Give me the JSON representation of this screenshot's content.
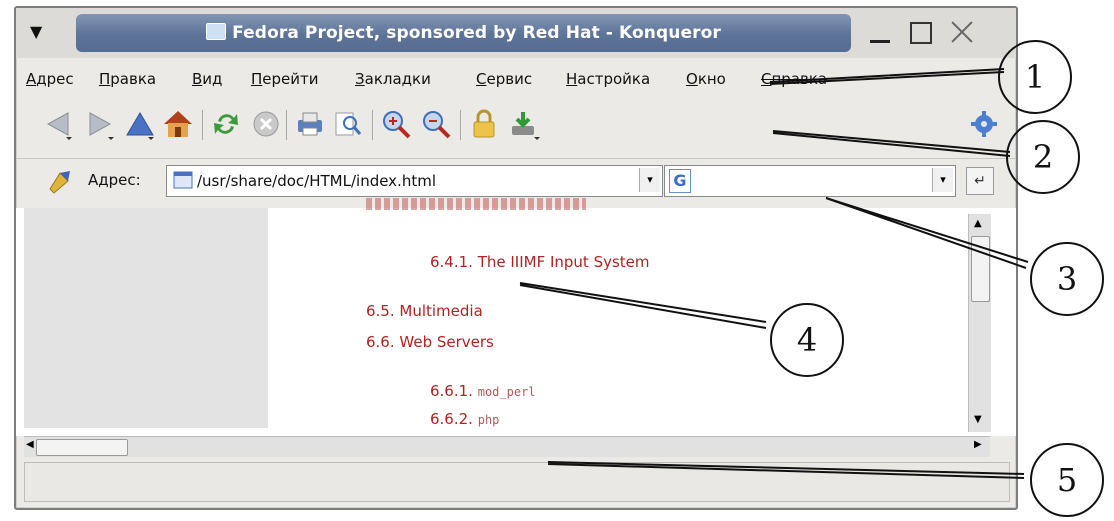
{
  "window": {
    "title": "Fedora Project, sponsored by Red Hat - Konqueror"
  },
  "menubar": {
    "items": [
      "Адрес",
      "Правка",
      "Вид",
      "Перейти",
      "Закладки",
      "Сервис",
      "Настройка",
      "Окно",
      "Справка"
    ]
  },
  "toolbar": {
    "buttons": [
      {
        "icon": "back-arrow-icon"
      },
      {
        "icon": "forward-arrow-icon"
      },
      {
        "icon": "up-arrow-icon"
      },
      {
        "icon": "home-icon"
      },
      {
        "icon": "reload-icon"
      },
      {
        "icon": "stop-icon"
      },
      {
        "icon": "print-icon"
      },
      {
        "icon": "find-icon"
      },
      {
        "icon": "zoom-in-icon"
      },
      {
        "icon": "zoom-out-icon"
      },
      {
        "icon": "lock-icon"
      },
      {
        "icon": "download-icon"
      },
      {
        "icon": "gear-icon"
      }
    ]
  },
  "address_bar": {
    "label": "Адрес:",
    "url": "/usr/share/doc/HTML/index.html",
    "search_engine_icon": "google-icon"
  },
  "content": {
    "links": [
      {
        "text": "6.4.1. The IIIMF Input System"
      },
      {
        "text": "6.5. Multimedia"
      },
      {
        "text": "6.6. Web Servers"
      },
      {
        "number": "6.6.1.",
        "code": "mod_perl"
      },
      {
        "number": "6.6.2.",
        "code": "php"
      }
    ]
  },
  "callouts": [
    "1",
    "2",
    "3",
    "4",
    "5"
  ],
  "colors": {
    "titlebar": "#5d7398",
    "link": "#b22222",
    "window_bg": "#ebeae6"
  }
}
